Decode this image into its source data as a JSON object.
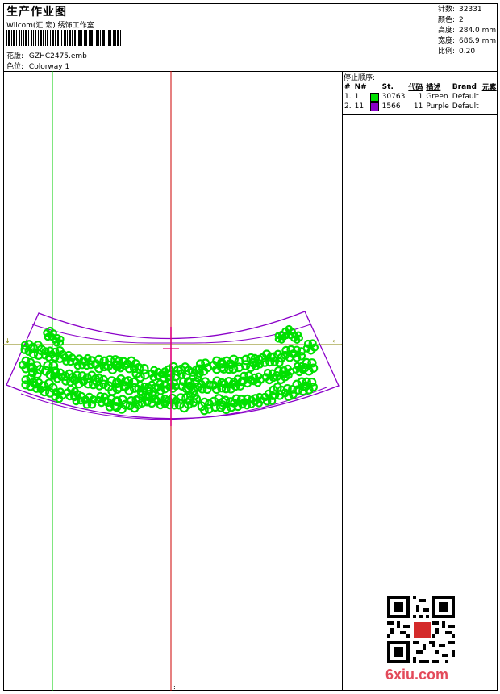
{
  "header": {
    "title": "生产作业图",
    "company": "Wilcom(汇 宏) 绣饰工作室",
    "design_label": "花版:",
    "design_value": "GZHC2475.emb",
    "colorway_label": "色位:",
    "colorway_value": "Colorway 1"
  },
  "stats": [
    {
      "label": "针数:",
      "value": "32331"
    },
    {
      "label": "颜色:",
      "value": "2"
    },
    {
      "label": "高度:",
      "value": "284.0 mm"
    },
    {
      "label": "宽度:",
      "value": "686.9 mm"
    },
    {
      "label": "比例:",
      "value": "0.20"
    }
  ],
  "stop_sequence": {
    "title": "停止顺序:",
    "columns": [
      "#",
      "N#",
      "St.",
      "代码",
      "描述",
      "Brand",
      "元素"
    ],
    "rows": [
      {
        "idx": "1.",
        "n": "1",
        "color": "#00e000",
        "st": "30763",
        "code": "1",
        "desc": "Green",
        "brand": "Default"
      },
      {
        "idx": "2.",
        "n": "11",
        "color": "#8a00c8",
        "st": "1566",
        "code": "11",
        "desc": "Purple",
        "brand": "Default"
      }
    ]
  },
  "watermark": {
    "text": "6xiu.com"
  },
  "colors": {
    "green": "#00e000",
    "purple": "#8a00c8",
    "guide_green": "#00cc00",
    "guide_red": "#cc0000",
    "olive": "#808000"
  }
}
